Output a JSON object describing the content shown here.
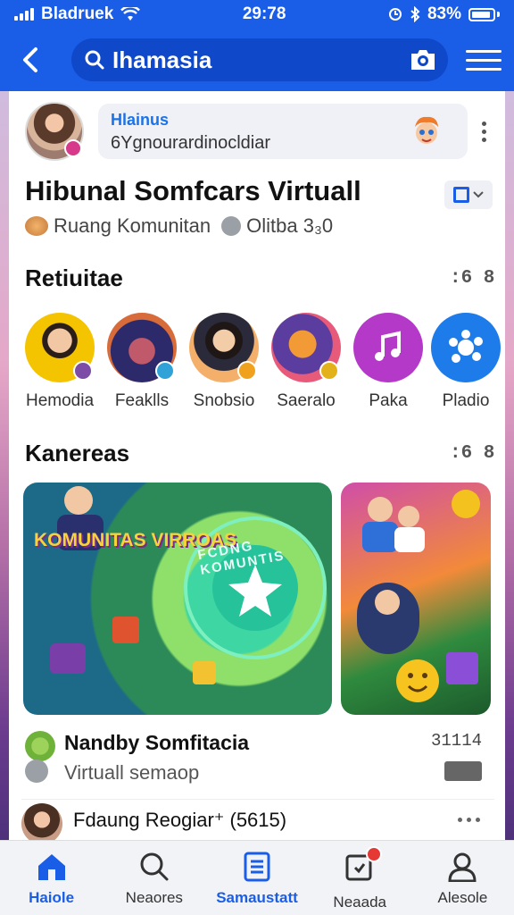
{
  "status_bar": {
    "carrier": "Bladruek",
    "time": "29:78",
    "battery": "83%"
  },
  "app_bar": {
    "search_text": "Ihamasia"
  },
  "profile_card": {
    "title": "Hlainus",
    "subtitle": "6Ygnourardinocldiar"
  },
  "group": {
    "title": "Hibunal Somfcars Virtuall",
    "meta_text": "Ruang Komunitan",
    "meta_count": "Olitba 3₃0"
  },
  "sections": {
    "stories": {
      "title": "Retiuitae",
      "action": ":6 8"
    },
    "featured": {
      "title": "Kanereas",
      "action": ":6 8"
    }
  },
  "stories": [
    {
      "label": "Hemodia",
      "bg": "#f2c400",
      "badge": "#7d4ca7"
    },
    {
      "label": "Feaklls",
      "bg": "#2c2a6a",
      "badge": "#30a2d8"
    },
    {
      "label": "Snobsio",
      "bg": "#f4b06a",
      "badge": "#f0a21e"
    },
    {
      "label": "Saeralo",
      "bg": "#5a3d9e",
      "badge": "#e3b21a"
    },
    {
      "label": "Paka",
      "bg": "#b539c8",
      "badge": ""
    },
    {
      "label": "Pladio",
      "bg": "#1e7bea",
      "badge": ""
    }
  ],
  "featured_cards": [
    {
      "banner": "KOMUNITAS VIRROAS",
      "ring_text": "FCDNG KOMUNTIS"
    },
    {
      "banner": ""
    }
  ],
  "list_items": [
    {
      "title": "Nandby Somfitacia",
      "subtitle": "Virtuall semaop",
      "count": "31114"
    },
    {
      "title": "Fdaung Reogiar⁺ (5615)"
    }
  ],
  "bottom_nav": [
    {
      "label": "Haiole",
      "icon": "home-icon",
      "active": true
    },
    {
      "label": "Neaores",
      "icon": "search-icon",
      "active": false
    },
    {
      "label": "Samaustatt",
      "icon": "list-icon",
      "active": true
    },
    {
      "label": "Neaada",
      "icon": "notifications-icon",
      "active": false
    },
    {
      "label": "Alesole",
      "icon": "profile-icon",
      "active": false
    }
  ],
  "colors": {
    "brand": "#1a5ee8",
    "surface": "#ffffff",
    "badge": "#e53935"
  }
}
